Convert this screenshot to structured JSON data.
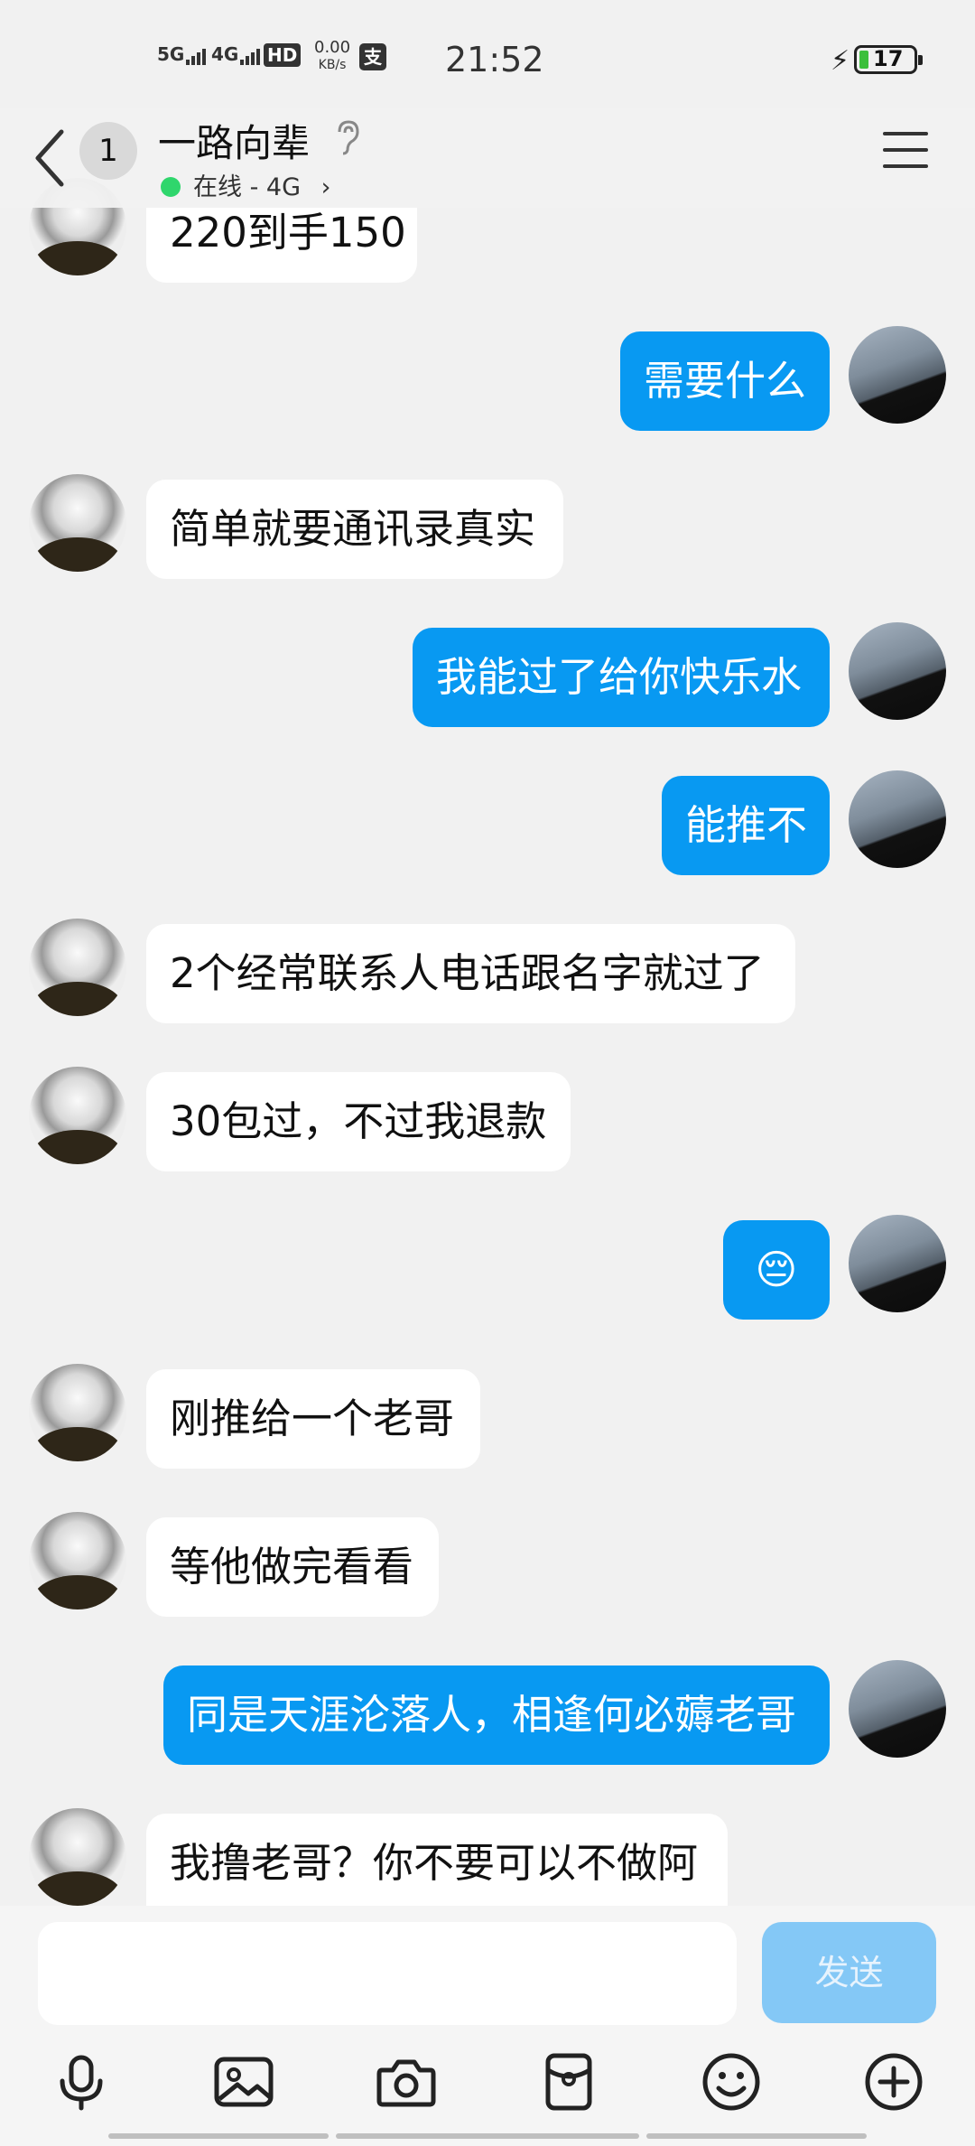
{
  "status_bar": {
    "net1": "5G",
    "net2": "4G",
    "hd": "HD",
    "speed_value": "0.00",
    "speed_unit": "KB/s",
    "time": "21:52",
    "battery": "17"
  },
  "header": {
    "unread_count": "1",
    "title": "一路向辈",
    "status": "在线 - 4G",
    "chevron": "›"
  },
  "messages": [
    {
      "from": "them",
      "text": "220到手150"
    },
    {
      "from": "me",
      "text": "需要什么"
    },
    {
      "from": "them",
      "text": "简单就要通讯录真实"
    },
    {
      "from": "me",
      "text": "我能过了给你快乐水"
    },
    {
      "from": "me",
      "text": "能推不"
    },
    {
      "from": "them",
      "text": "2个经常联系人电话跟名字就过了"
    },
    {
      "from": "them",
      "text": "30包过，不过我退款"
    },
    {
      "from": "me",
      "text": "😔"
    },
    {
      "from": "them",
      "text": "刚推给一个老哥"
    },
    {
      "from": "them",
      "text": "等他做完看看"
    },
    {
      "from": "me",
      "text": "同是天涯沦落人，相逢何必薅老哥"
    },
    {
      "from": "them",
      "text": "我撸老哥？你不要可以不做阿"
    }
  ],
  "input": {
    "value": "",
    "send_label": "发送"
  },
  "toolbar": {
    "icons": [
      "microphone-icon",
      "image-icon",
      "camera-icon",
      "red-packet-icon",
      "emoji-icon",
      "plus-icon"
    ]
  },
  "colors": {
    "my_bubble": "#0899f2",
    "their_bubble": "#ffffff",
    "background": "#f1f1f1",
    "send_button": "#84c8f6",
    "online_dot": "#2fd66c"
  }
}
